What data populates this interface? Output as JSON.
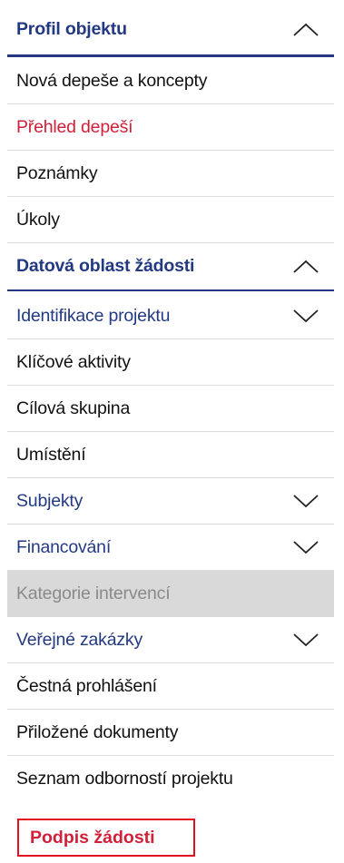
{
  "menu": {
    "profil_objektu": "Profil objektu",
    "nova_depese": "Nová depeše a koncepty",
    "prehled_depesi": "Přehled depeší",
    "poznamky": "Poznámky",
    "ukoly": "Úkoly",
    "datova_oblast": "Datová oblast žádosti",
    "identifikace_projektu": "Identifikace projektu",
    "klicove_aktivity": "Klíčové aktivity",
    "cilova_skupina": "Cílová skupina",
    "umisteni": "Umístění",
    "subjekty": "Subjekty",
    "financovani": "Financování",
    "kategorie_intervenci": "Kategorie intervencí",
    "verejne_zakazky": "Veřejné zakázky",
    "cestna_prohlaseni": "Čestná prohlášení",
    "prilozene_dokumenty": "Přiložené dokumenty",
    "seznam_odbornosti": "Seznam odborností projektu",
    "podpis_zadosti": "Podpis žádosti"
  },
  "icons": {
    "collapse": "chevron-up-icon",
    "expand": "chevron-down-icon"
  },
  "colors": {
    "header_text": "#233a83",
    "active_text": "#d0213a",
    "highlight_border": "#e3101e",
    "disabled_bg": "#d9d9d9"
  }
}
